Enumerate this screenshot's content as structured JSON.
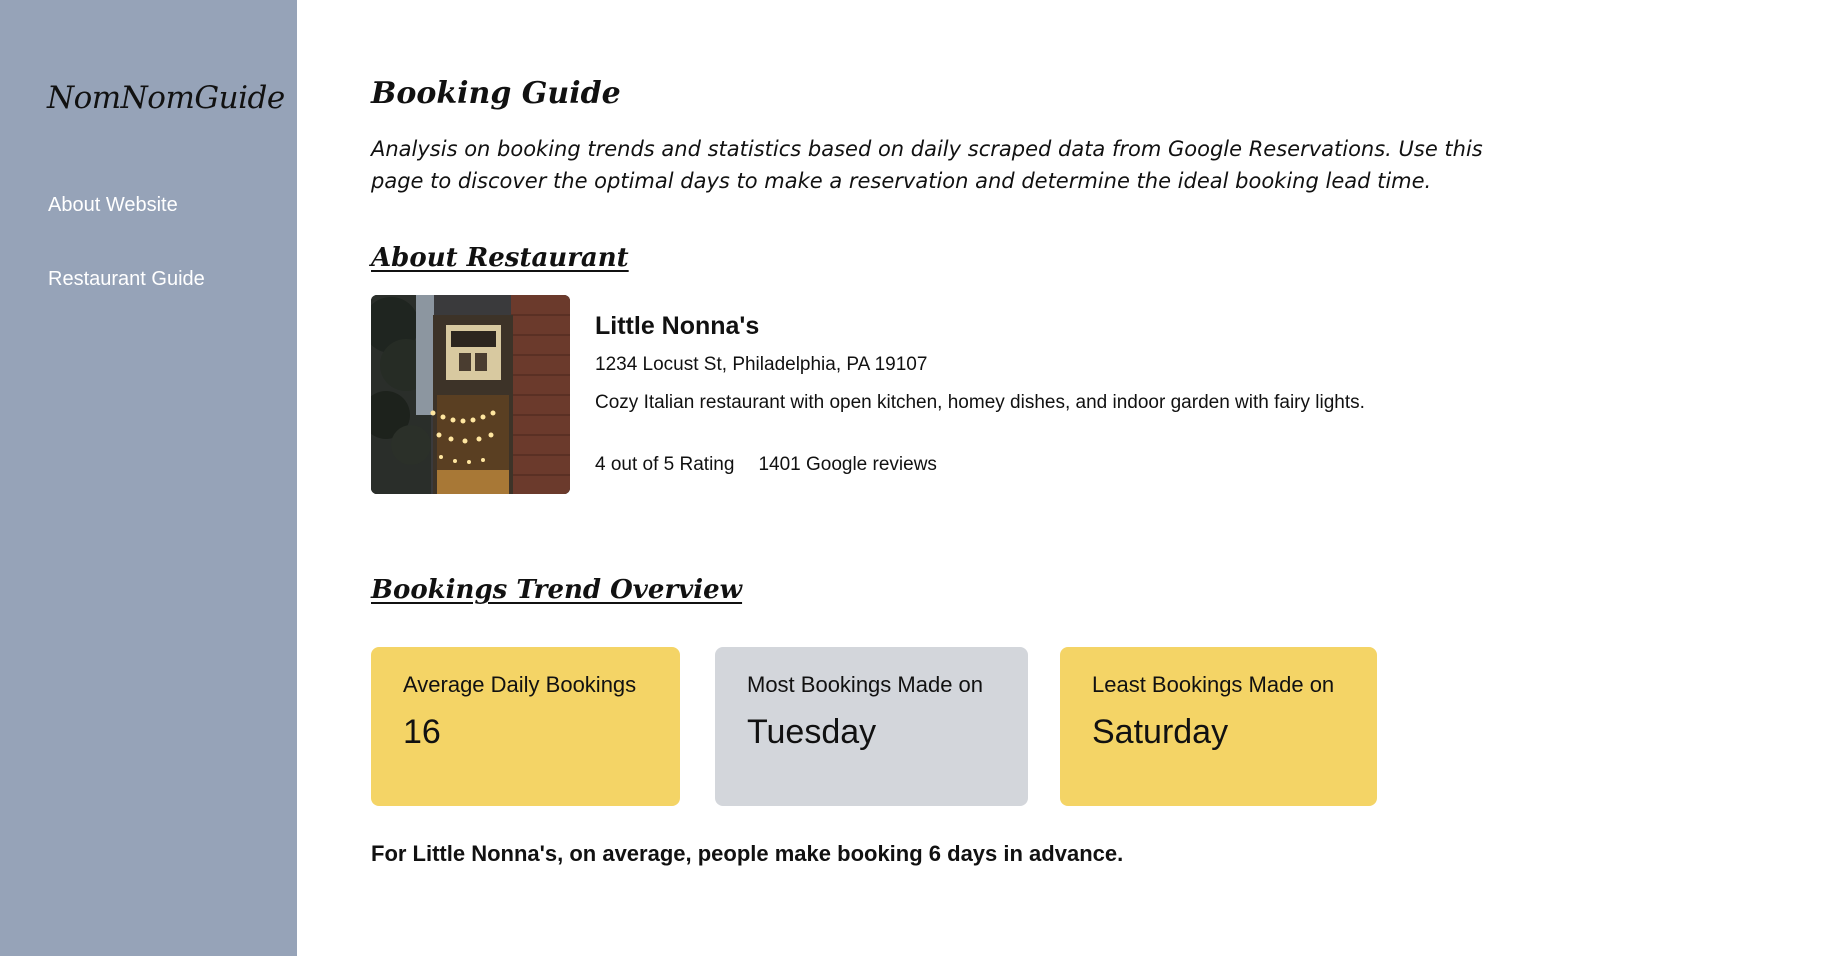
{
  "sidebar": {
    "logo": "NomNomGuide",
    "items": [
      {
        "label": "About Website"
      },
      {
        "label": "Restaurant Guide"
      }
    ]
  },
  "page": {
    "title": "Booking Guide",
    "intro": "Analysis on booking trends and statistics based on daily scraped data from Google Reservations. Use this page to discover the optimal days to make a reservation and determine the ideal booking lead time."
  },
  "about": {
    "section_title": "About Restaurant",
    "name": "Little Nonna's",
    "address": "1234 Locust St, Philadelphia, PA 19107",
    "description": "Cozy Italian restaurant with open kitchen, homey dishes, and indoor garden with fairy lights.",
    "rating": "4 out of 5 Rating",
    "reviews": "1401 Google reviews"
  },
  "trend": {
    "section_title": "Bookings Trend Overview",
    "cards": [
      {
        "label": "Average Daily Bookings",
        "value": "16",
        "color": "#f4d466"
      },
      {
        "label": "Most Bookings Made on",
        "value": "Tuesday",
        "color": "#d3d6db"
      },
      {
        "label": "Least Bookings Made on",
        "value": "Saturday",
        "color": "#f4d466"
      }
    ],
    "summary": "For Little Nonna's, on average, people make booking 6 days in advance."
  },
  "colors": {
    "sidebar": "#96a3b8",
    "accent_yellow": "#f4d466",
    "accent_gray": "#d3d6db"
  }
}
